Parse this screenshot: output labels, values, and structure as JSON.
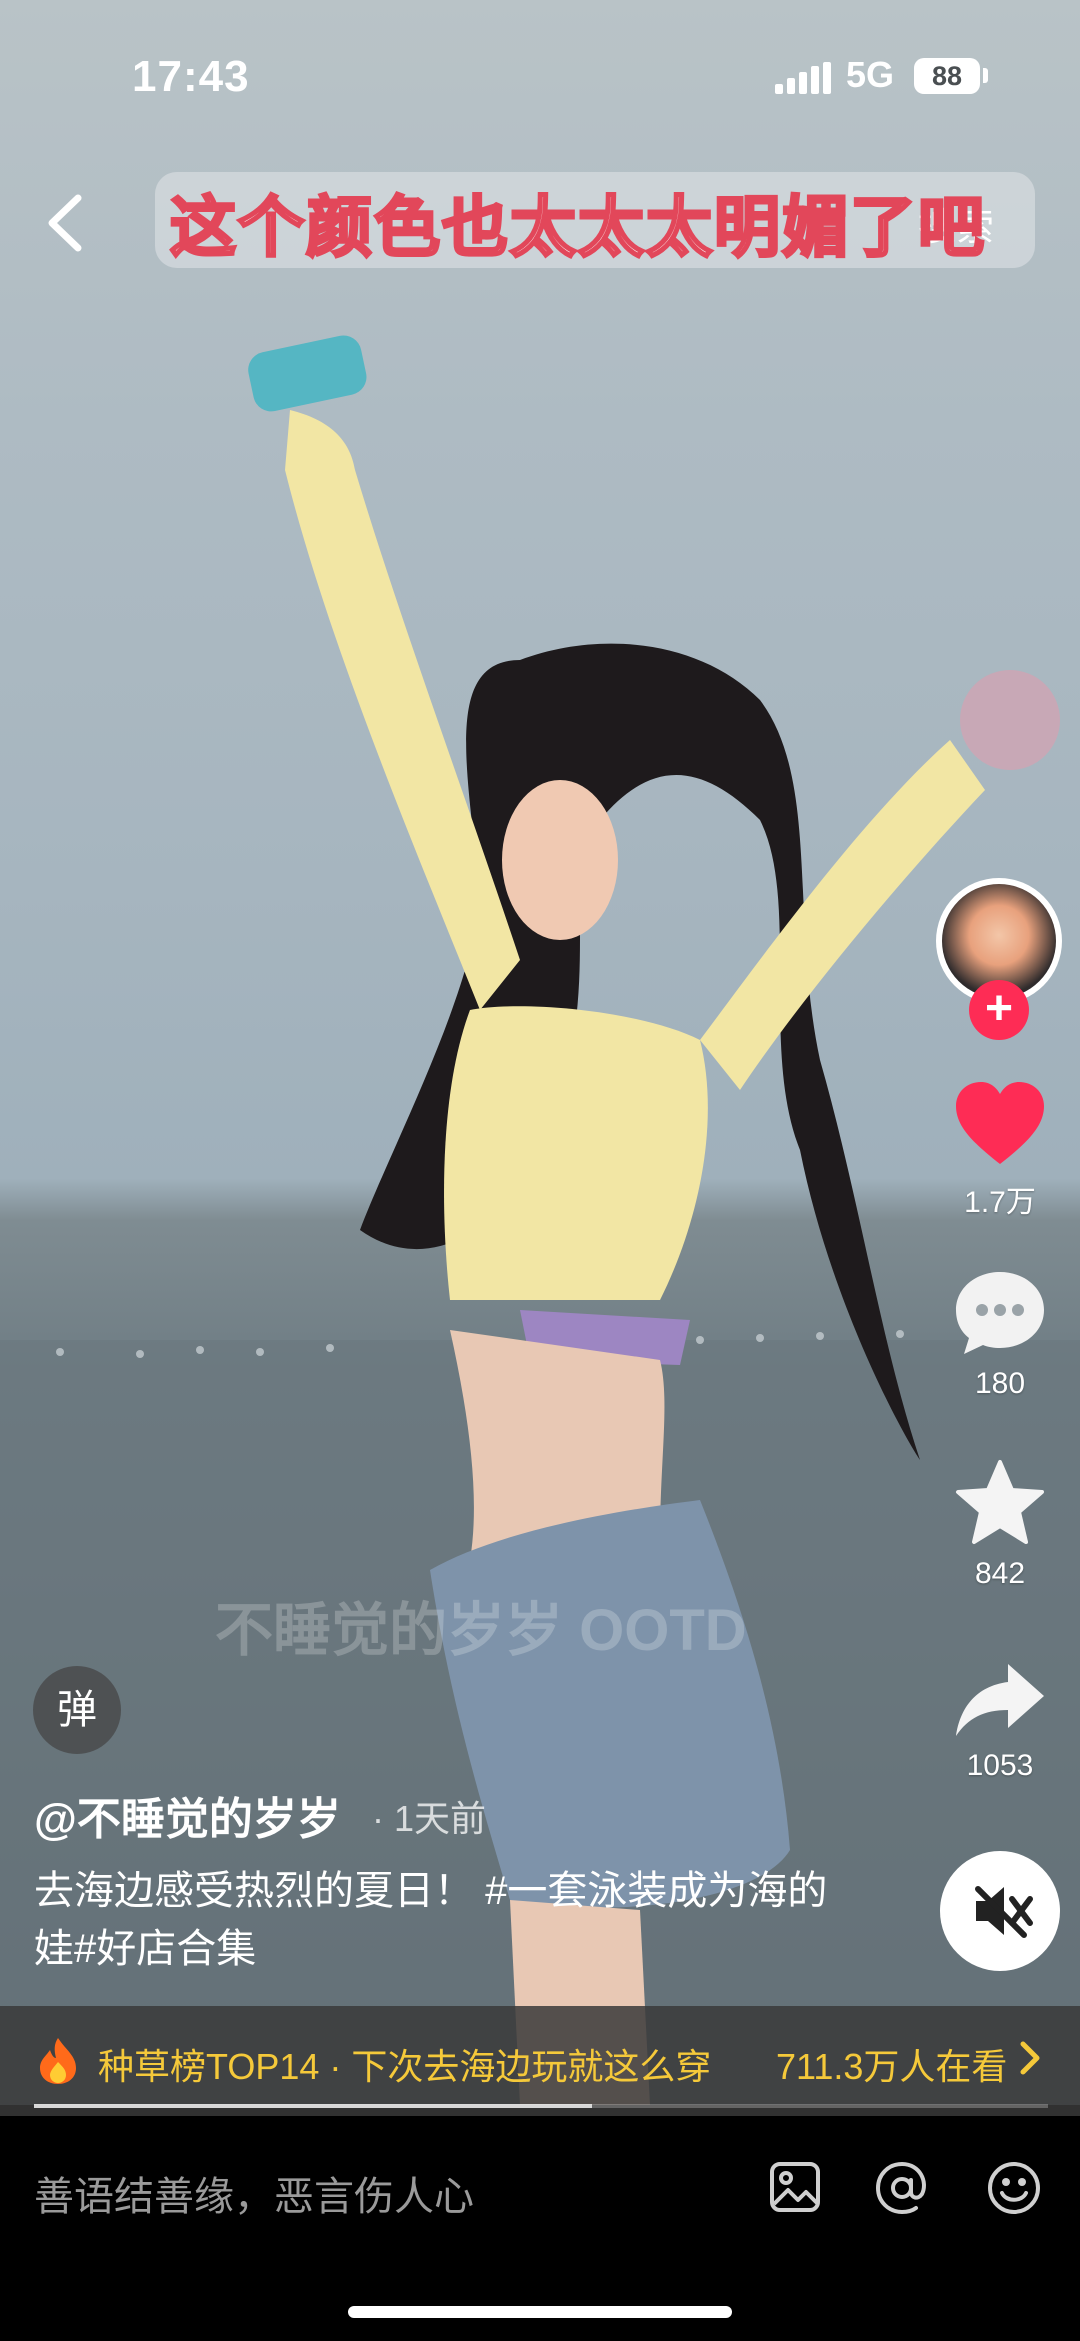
{
  "status": {
    "time": "17:43",
    "network": "5G",
    "battery": "88"
  },
  "top": {
    "caption": "这个颜色也太太太明媚了吧",
    "search_label": "搜索"
  },
  "side": {
    "like_count": "1.7万",
    "comment_count": "180",
    "favorite_count": "842",
    "share_count": "1053",
    "follow_symbol": "+"
  },
  "video": {
    "watermark": "不睡觉的岁岁 OOTD",
    "progress_fraction": 0.55
  },
  "danmaku_label": "弹",
  "post": {
    "author": "@不睡觉的岁岁",
    "time_ago": "· 1天前",
    "description": "去海边感受热烈的夏日！ #一套泳装成为海的娃#好店合集"
  },
  "rank": {
    "text": "种草榜TOP14 · 下次去海边玩就这么穿",
    "watching": "711.3万人在看"
  },
  "comment": {
    "placeholder": "善语结善缘，恶言伤人心"
  },
  "colors": {
    "like": "#fe2c55",
    "rank": "#f5c93a",
    "caption_stroke": "#e2475a"
  },
  "icons": [
    "back-arrow-icon",
    "heart-icon",
    "comment-icon",
    "star-icon",
    "share-icon",
    "mute-icon",
    "flame-icon",
    "chevron-right-icon",
    "image-icon",
    "at-icon",
    "emoji-icon"
  ]
}
